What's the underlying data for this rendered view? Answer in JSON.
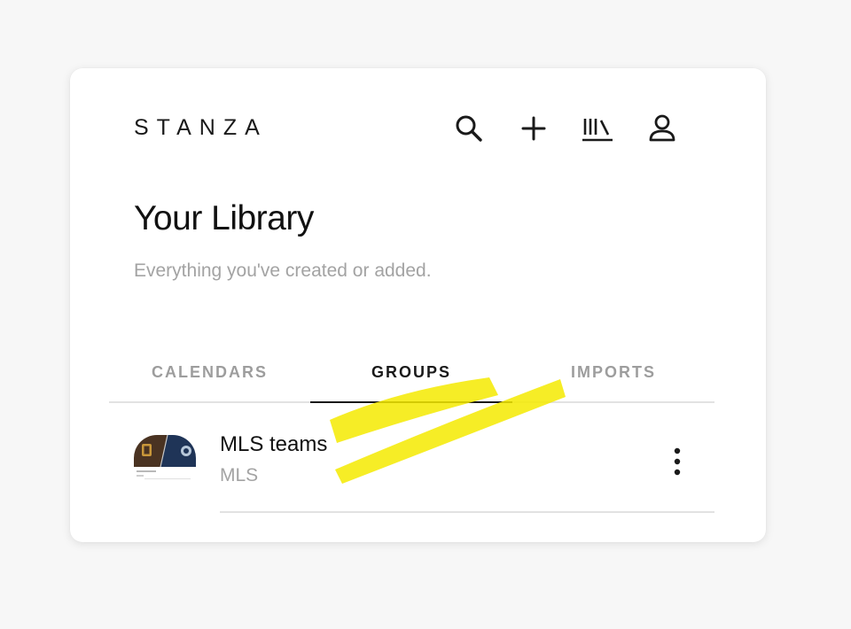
{
  "header": {
    "logo": "STANZA",
    "icons": [
      "search-icon",
      "plus-icon",
      "library-icon",
      "profile-icon"
    ]
  },
  "page": {
    "title": "Your Library",
    "subtitle": "Everything you've created or added."
  },
  "tabs": [
    {
      "label": "CALENDARS",
      "active": false
    },
    {
      "label": "GROUPS",
      "active": true
    },
    {
      "label": "IMPORTS",
      "active": false
    }
  ],
  "groups": [
    {
      "name": "MLS teams",
      "subtitle": "MLS",
      "menu_icon": "more-vertical-icon"
    }
  ],
  "colors": {
    "text_primary": "#111111",
    "text_muted": "#a3a3a3",
    "divider": "#e2e2e2",
    "highlight": "#f5ea00"
  }
}
